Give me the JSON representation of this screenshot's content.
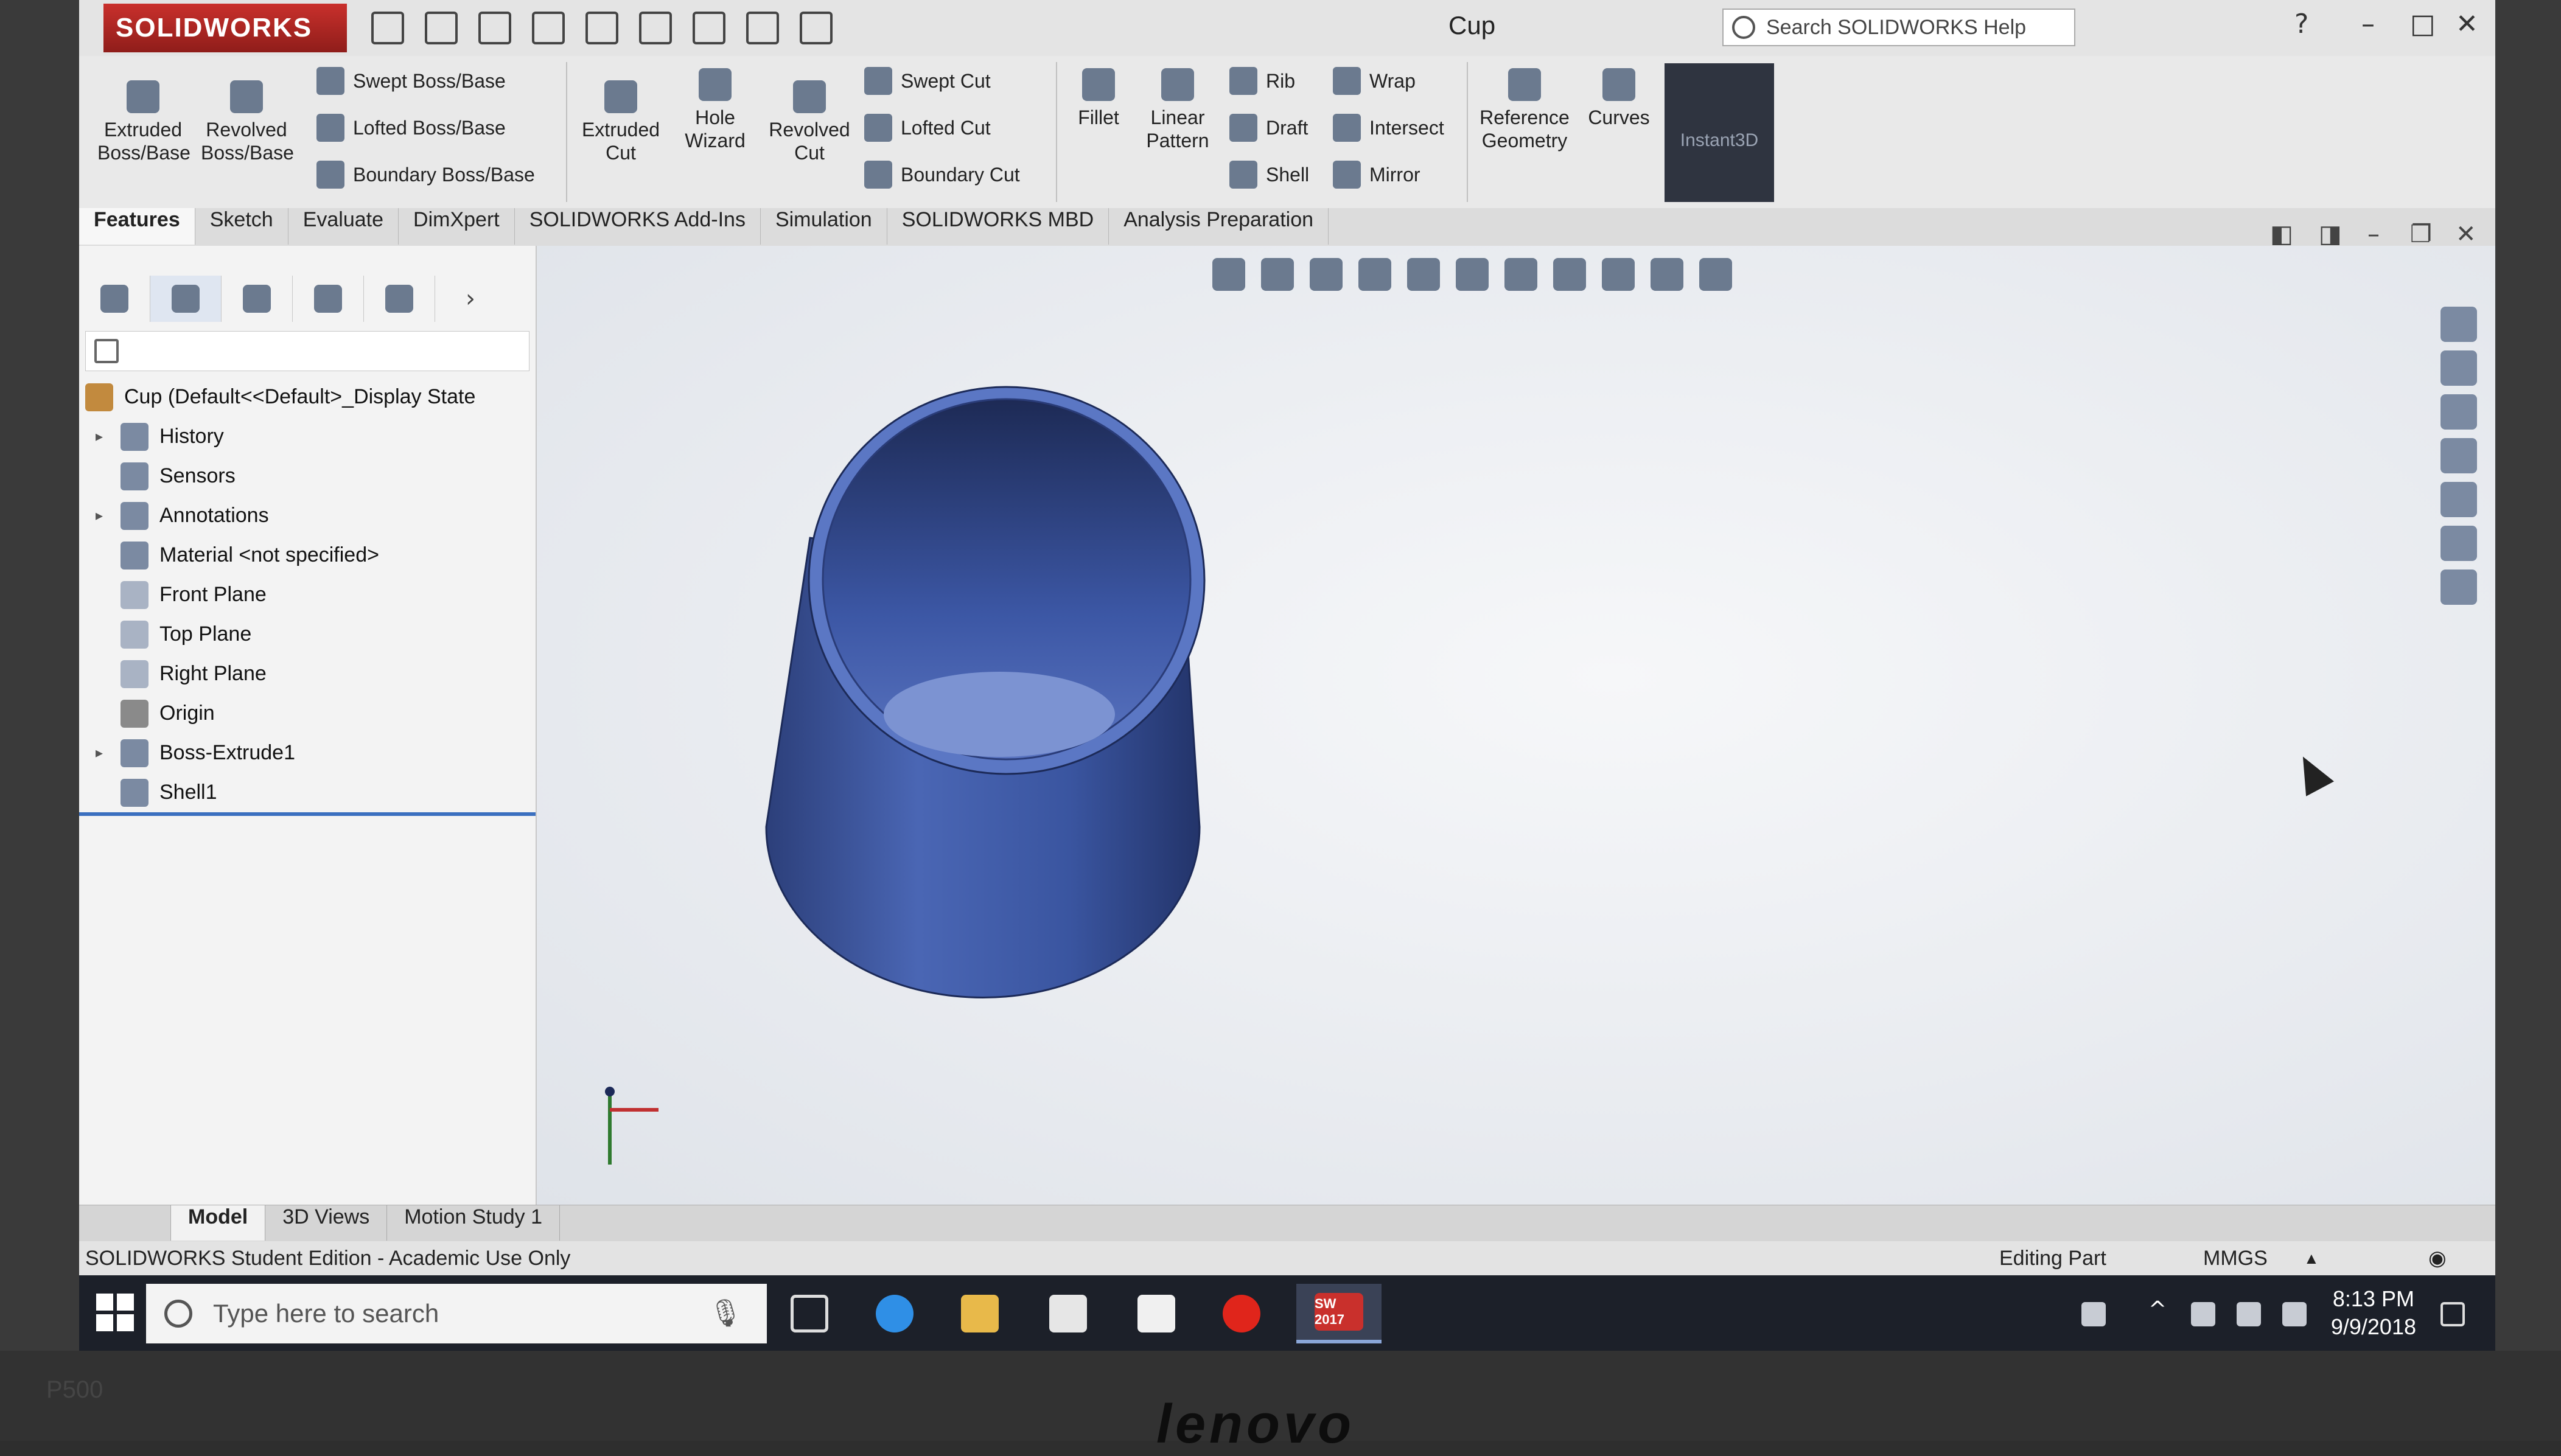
{
  "app": {
    "brand": "SOLIDWORKS",
    "document_title": "Cup",
    "help_search_placeholder": "Search SOLIDWORKS Help"
  },
  "ribbon": {
    "extruded_boss": "Extruded Boss/Base",
    "revolved_boss": "Revolved Boss/Base",
    "swept_boss": "Swept Boss/Base",
    "lofted_boss": "Lofted Boss/Base",
    "boundary_boss": "Boundary Boss/Base",
    "extruded_cut": "Extruded Cut",
    "hole_wizard": "Hole Wizard",
    "revolved_cut": "Revolved Cut",
    "swept_cut": "Swept Cut",
    "lofted_cut": "Lofted Cut",
    "boundary_cut": "Boundary Cut",
    "fillet": "Fillet",
    "linear_pattern": "Linear Pattern",
    "rib": "Rib",
    "draft": "Draft",
    "shell": "Shell",
    "wrap": "Wrap",
    "intersect": "Intersect",
    "mirror": "Mirror",
    "reference_geometry": "Reference Geometry",
    "curves": "Curves",
    "instant3d": "Instant3D"
  },
  "tabs": [
    "Features",
    "Sketch",
    "Evaluate",
    "DimXpert",
    "SOLIDWORKS Add-Ins",
    "Simulation",
    "SOLIDWORKS MBD",
    "Analysis Preparation"
  ],
  "tree": {
    "root": "Cup  (Default<<Default>_Display State",
    "items": [
      "History",
      "Sensors",
      "Annotations",
      "Material <not specified>",
      "Front Plane",
      "Top Plane",
      "Right Plane",
      "Origin",
      "Boss-Extrude1",
      "Shell1"
    ]
  },
  "bottom_tabs": [
    "Model",
    "3D Views",
    "Motion Study 1"
  ],
  "status": {
    "edition": "SOLIDWORKS Student Edition - Academic Use Only",
    "mode": "Editing Part",
    "units": "MMGS"
  },
  "taskbar": {
    "search_placeholder": "Type here to search",
    "time": "8:13 PM",
    "date": "9/9/2018",
    "sw_badge": "SW 2017"
  },
  "hardware": {
    "brand": "lenovo",
    "model": "P500"
  },
  "colors": {
    "model_blue": "#3d59a6",
    "selection": "#3a6fbf",
    "logo_red": "#c9302c"
  }
}
